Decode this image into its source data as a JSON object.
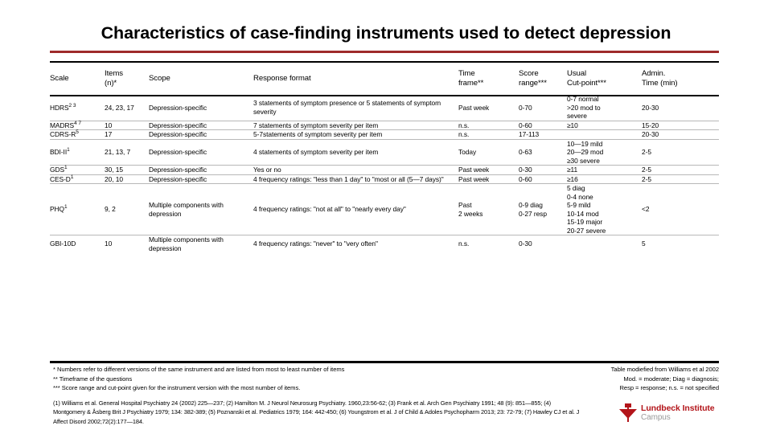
{
  "slide": {
    "title": "Characteristics of case-finding instruments used to detect depression",
    "accent_red": "#9e2a2a",
    "logo_red": "#b3151a"
  },
  "table": {
    "headers": {
      "scale": "Scale",
      "items": "Items\n(n)*",
      "scope": "Scope",
      "response_format": "Response format",
      "time_frame": "Time\nframe**",
      "score_range": "Score\nrange***",
      "cut_point": "Usual\nCut-point***",
      "admin_time": "Admin.\nTime (min)"
    },
    "rows": [
      {
        "scale": "HDRS",
        "scale_sup": "2 3",
        "items": "24, 23, 17",
        "scope": "Depression-specific",
        "response_format": "3 statements of symptom presence or 5 statements of symptom severity",
        "time_frame": "Past week",
        "score_range": "0-70",
        "cut_point": "0-7 normal\n>20 mod to\nsevere",
        "admin_time": "20-30"
      },
      {
        "scale": "MADRS",
        "scale_sup": "4 7",
        "items": "10",
        "scope": "Depression-specific",
        "response_format": "7 statements of symptom severity per item",
        "time_frame": "n.s.",
        "score_range": "0-60",
        "cut_point": "≥10",
        "admin_time": "15-20"
      },
      {
        "scale": "CDRS-R",
        "scale_sup": "5",
        "items": "17",
        "scope": "Depression-specific",
        "response_format": "5-7statements of symptom severity per item",
        "time_frame": "n.s.",
        "score_range": "17-113",
        "cut_point": "",
        "admin_time": "20-30"
      },
      {
        "scale": "BDI-II",
        "scale_sup": "1",
        "items": "21, 13, 7",
        "scope": "Depression-specific",
        "response_format": "4 statements of symptom severity per item",
        "time_frame": "Today",
        "score_range": "0-63",
        "cut_point": "10—19 mild\n20—29 mod\n≥30 severe",
        "admin_time": "2-5"
      },
      {
        "scale": "GDS",
        "scale_sup": "1",
        "items": "30, 15",
        "scope": "Depression-specific",
        "response_format": "Yes or no",
        "time_frame": "Past week",
        "score_range": "0-30",
        "cut_point": "≥11",
        "admin_time": "2-5"
      },
      {
        "scale": "CES-D",
        "scale_sup": "1",
        "items": "20, 10",
        "scope": "Depression-specific",
        "response_format": "4 frequency ratings: \"less than 1 day\" to \"most or all (5—7 days)\"",
        "time_frame": "Past week",
        "score_range": "0-60",
        "cut_point": "≥16",
        "admin_time": "2-5"
      },
      {
        "scale": "PHQ",
        "scale_sup": "1",
        "items": "9, 2",
        "scope": "Multiple components with depression",
        "response_format": "4 frequency ratings: \"not at all\" to \"nearly every day\"",
        "time_frame": "Past\n2 weeks",
        "score_range": "0-9 diag\n0-27 resp",
        "cut_point": "5 diag\n0-4 none\n5-9 mild\n10-14 mod\n15-19 major\n20-27 severe",
        "admin_time": "<2"
      },
      {
        "scale": "GBI-10D",
        "scale_sup": "",
        "items": "10",
        "scope": "Multiple components with depression",
        "response_format": "4 frequency ratings: \"never\" to \"very often\"",
        "time_frame": "n.s.",
        "score_range": "0-30",
        "cut_point": "",
        "admin_time": "5"
      }
    ]
  },
  "footnotes": {
    "line1": "* Numbers refer to different versions of the same instrument and are listed from most to least number of items",
    "line2": "** Timeframe of the questions",
    "line3": "*** Score range and cut-point given for the instrument version with the most number of items."
  },
  "footnotes_right": {
    "line1": "Table modiefied from Williams et al 2002",
    "line2": "Mod. = moderate; Diag = diagnosis;",
    "line3": "Resp = response; n.s. = not specified"
  },
  "references": {
    "text": "(1) Williams et al. General Hospital Psychiatry 24 (2002) 225—237; (2) Hamilton M. J Neurol Neurosurg Psychiatry. 1960,23:56-62; (3) Frank et al. Arch Gen Psychiatry 1991; 48 (9): 851—855; (4) Montgomery & Åsberg Brit J Psychiatry 1979; 134: 382-389; (5) Poznanski et al. Pediatrics 1979; 164: 442-450; (6) Youngstrom et al. J of Child & Adoles Psychopharm 2013; 23: 72-79; (7) Hawley CJ et al. J Affect Disord 2002;72(2):177—184."
  },
  "logo": {
    "line1": "Lundbeck Institute",
    "line2": "Campus"
  }
}
